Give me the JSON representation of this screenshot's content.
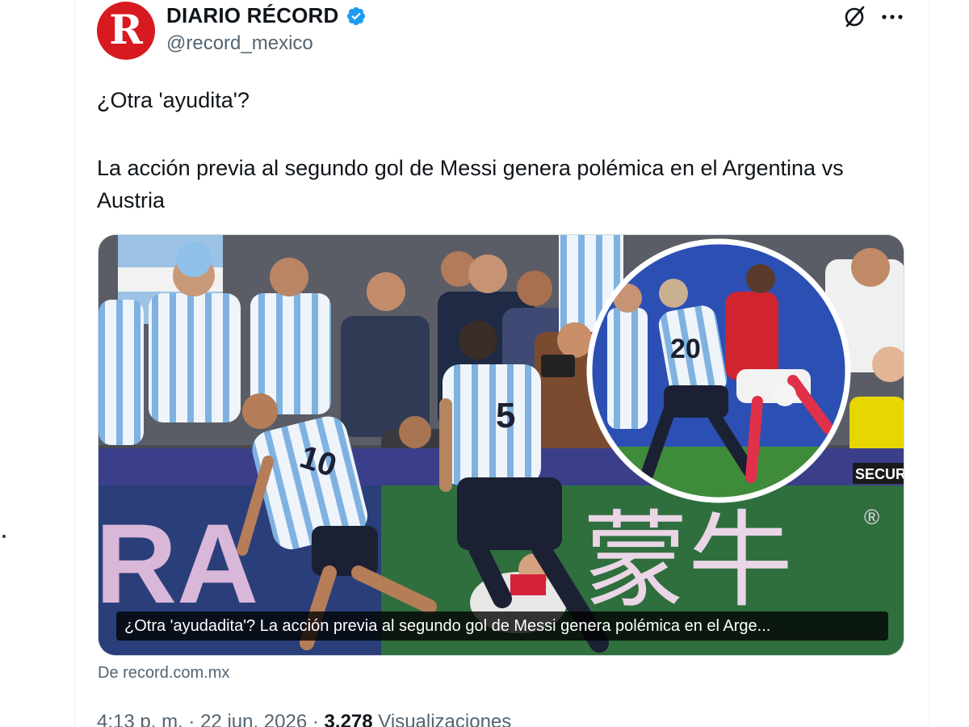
{
  "account": {
    "display_name": "DIARIO RÉCORD",
    "handle": "@record_mexico",
    "avatar_letter": "R",
    "avatar_color": "#d71920",
    "verified": true,
    "verified_color": "#1d9bf0"
  },
  "actions": {
    "grok_icon": "grok-slash-circle-icon",
    "more_icon": "more-horizontal-icon"
  },
  "tweet": {
    "line1": "¿Otra 'ayudita'?",
    "line2": "La acción previa al segundo gol de Messi genera polémica en el Argentina vs Austria"
  },
  "media": {
    "caption": "¿Otra 'ayudadita'? La acción previa al segundo gol de Messi genera polémica en el Arge...",
    "scene_text": {
      "jersey_left": "10",
      "jersey_center": "5",
      "jersey_inset": "20",
      "board_latin": "RA",
      "board_chinese": "蒙牛",
      "registered": "®",
      "security_vest": "SECURI"
    }
  },
  "source": "De record.com.mx",
  "meta": {
    "time": "4:13 p. m.",
    "separator": "·",
    "date": "22 jun. 2026",
    "views_count": "3.278",
    "views_label": "Visualizaciones"
  }
}
